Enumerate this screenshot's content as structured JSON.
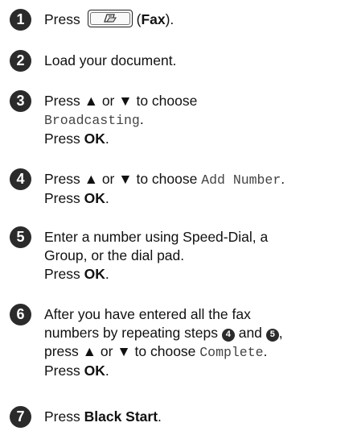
{
  "colors": {
    "step_circle": "#2b2b2b",
    "mono_text": "#444444"
  },
  "icons": {
    "fax_button": "fax-icon",
    "up": "▲",
    "down": "▼"
  },
  "steps": [
    {
      "number": "1",
      "press": "Press",
      "paren_open": "(",
      "fax_label": "Fax",
      "paren_close": ")."
    },
    {
      "number": "2",
      "text": "Load your document."
    },
    {
      "number": "3",
      "text": "Press",
      "or": "or",
      "to_choose": "to choose",
      "option": "Broadcasting",
      "period": ".",
      "press_ok": "Press",
      "ok": "OK",
      "ok_period": "."
    },
    {
      "number": "4",
      "text": "Press",
      "or": "or",
      "to_choose": "to choose",
      "option": "Add Number",
      "period": ".",
      "press_ok": "Press",
      "ok": "OK",
      "ok_period": "."
    },
    {
      "number": "5",
      "line1": "Enter a number using Speed-Dial, a",
      "line2": "Group, or the dial pad.",
      "press_ok": "Press",
      "ok": "OK",
      "ok_period": "."
    },
    {
      "number": "6",
      "line1": "After you have entered all the fax",
      "line2_a": "numbers by repeating steps",
      "ref_a": "4",
      "and": "and",
      "ref_b": "5",
      "comma": ",",
      "line3_a": "press",
      "or": "or",
      "to_choose": "to choose",
      "option": "Complete",
      "period": ".",
      "press_ok": "Press",
      "ok": "OK",
      "ok_period": "."
    },
    {
      "number": "7",
      "press": "Press",
      "button": "Black Start",
      "period": "."
    }
  ]
}
